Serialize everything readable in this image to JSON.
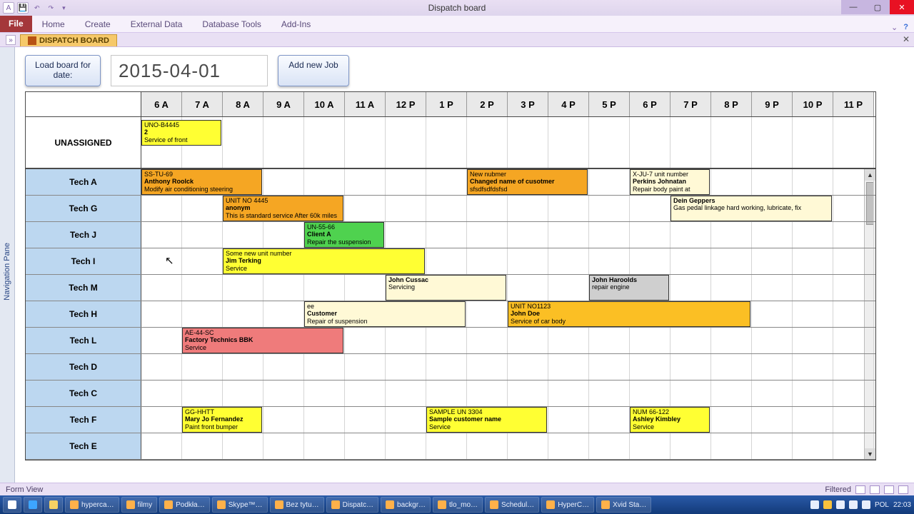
{
  "window": {
    "title": "Dispatch board"
  },
  "ribbon": {
    "file": "File",
    "tabs": [
      "Home",
      "Create",
      "External Data",
      "Database Tools",
      "Add-Ins"
    ]
  },
  "docTab": {
    "label": "DISPATCH BOARD"
  },
  "navPane": {
    "label": "Navigation Pane"
  },
  "controls": {
    "loadLabel": "Load board for date:",
    "dateValue": "2015-04-01",
    "addJob": "Add new Job"
  },
  "hours": [
    "6 A",
    "7 A",
    "8 A",
    "9 A",
    "10 A",
    "11 A",
    "12 P",
    "1 P",
    "2 P",
    "3 P",
    "4 P",
    "5 P",
    "6 P",
    "7 P",
    "8 P",
    "9 P",
    "10 P",
    "11 P"
  ],
  "unassigned": {
    "label": "UNASSIGNED",
    "jobs": [
      {
        "start": 0,
        "span": 2,
        "color": "c-yellow",
        "l1": "UNO-B4445",
        "l2": "2",
        "l3": "Service of front"
      }
    ]
  },
  "techs": [
    {
      "name": "Tech A",
      "jobs": [
        {
          "start": 0,
          "span": 3,
          "color": "c-orange",
          "l1": "SS-TU-69",
          "l2": "Anthony Roolck",
          "l3": "Modify air conditioning steering"
        },
        {
          "start": 8,
          "span": 3,
          "color": "c-orange",
          "l1": "New nubmer",
          "l2": "Changed name of cusotmer",
          "l3": "sfsdfsdfdsfsd"
        },
        {
          "start": 12,
          "span": 2,
          "color": "c-cream",
          "l1": "X-JU-7 unit number",
          "l2": "Perkins Johnatan",
          "l3": "Repair body paint at"
        }
      ]
    },
    {
      "name": "Tech G",
      "jobs": [
        {
          "start": 2,
          "span": 3,
          "color": "c-orange",
          "l1": "UNIT NO 4445",
          "l2": "anonym",
          "l3": "This is standard service After 60k miles"
        },
        {
          "start": 13,
          "span": 4,
          "color": "c-cream",
          "l1": "",
          "l2": "Dein Geppers",
          "l3": "Gas pedal linkage hard working, lubricate, fix"
        }
      ]
    },
    {
      "name": "Tech J",
      "jobs": [
        {
          "start": 4,
          "span": 2,
          "color": "c-green",
          "l1": "UN-55-66",
          "l2": "Client A",
          "l3": "Repair the suspension"
        }
      ]
    },
    {
      "name": "Tech I",
      "jobs": [
        {
          "start": 2,
          "span": 5,
          "color": "c-yellow",
          "l1": "Some new unit number",
          "l2": "Jim Terking",
          "l3": "Service"
        }
      ]
    },
    {
      "name": "Tech M",
      "jobs": [
        {
          "start": 6,
          "span": 3,
          "color": "c-cream",
          "l1": "",
          "l2": "John Cussac",
          "l3": "Servicing"
        },
        {
          "start": 11,
          "span": 2,
          "color": "c-gray",
          "l1": "",
          "l2": "John Haroolds",
          "l3": "repair engine"
        }
      ]
    },
    {
      "name": "Tech H",
      "jobs": [
        {
          "start": 4,
          "span": 4,
          "color": "c-cream",
          "l1": "ee",
          "l2": "Customer",
          "l3": "Repair of suspension"
        },
        {
          "start": 9,
          "span": 6,
          "color": "c-amber",
          "l1": "UNIT NO1123",
          "l2": "John Doe",
          "l3": "Service of car body"
        }
      ]
    },
    {
      "name": "Tech L",
      "jobs": [
        {
          "start": 1,
          "span": 4,
          "color": "c-red",
          "l1": "AE-44-SC",
          "l2": "Factory Technics BBK",
          "l3": "Service"
        }
      ]
    },
    {
      "name": "Tech D",
      "jobs": []
    },
    {
      "name": "Tech C",
      "jobs": []
    },
    {
      "name": "Tech F",
      "jobs": [
        {
          "start": 1,
          "span": 2,
          "color": "c-yellow",
          "l1": "GG-HHTT",
          "l2": "Mary Jo Fernandez",
          "l3": "Paint front bumper"
        },
        {
          "start": 7,
          "span": 3,
          "color": "c-yellow",
          "l1": "SAMPLE UN 3304",
          "l2": "Sample customer name",
          "l3": "Service"
        },
        {
          "start": 12,
          "span": 2,
          "color": "c-yellow",
          "l1": "NUM 66-122",
          "l2": "Ashley Kimbley",
          "l3": "Service"
        }
      ]
    },
    {
      "name": "Tech E",
      "jobs": []
    }
  ],
  "status": {
    "left": "Form View",
    "right": "Filtered"
  },
  "taskbar": {
    "items": [
      "hyperca…",
      "filmy",
      "Podkła…",
      "Skype™…",
      "Bez tytu…",
      "Dispatc…",
      "backgr…",
      "tlo_mo…",
      "Schedul…",
      "HyperC…",
      "Xvid Sta…"
    ],
    "tray": {
      "lang": "POL",
      "time": "22:03"
    }
  }
}
